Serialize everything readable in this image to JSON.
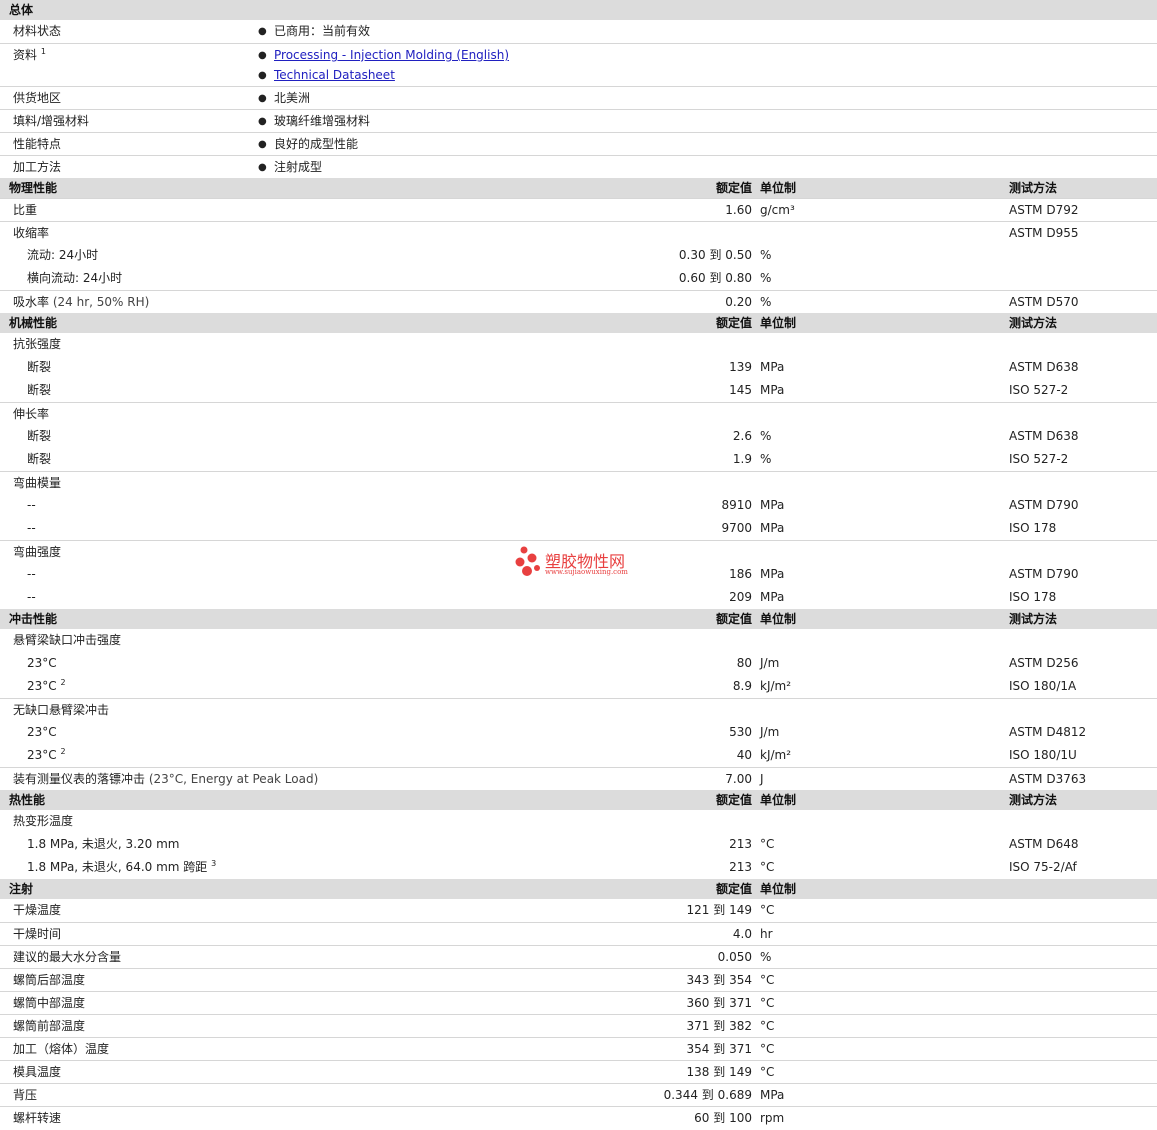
{
  "general": {
    "title": "总体",
    "rows": [
      {
        "label": "材料状态",
        "items": [
          {
            "text": "已商用：当前有效"
          }
        ]
      },
      {
        "label": "资料",
        "note": "1",
        "items": [
          {
            "text": "Processing - Injection Molding (English)",
            "link": true
          },
          {
            "text": "Technical Datasheet",
            "link": true
          }
        ]
      },
      {
        "label": "供货地区",
        "items": [
          {
            "text": "北美洲"
          }
        ]
      },
      {
        "label": "填料/增强材料",
        "items": [
          {
            "text": "玻璃纤维增强材料"
          }
        ]
      },
      {
        "label": "性能特点",
        "items": [
          {
            "text": "良好的成型性能"
          }
        ]
      },
      {
        "label": "加工方法",
        "items": [
          {
            "text": "注射成型"
          }
        ]
      }
    ]
  },
  "col_value": "额定值",
  "col_unit": "单位制",
  "col_method": "测试方法",
  "bullet": "●",
  "to": "到",
  "sections": [
    {
      "title": "物理性能",
      "show_method": true,
      "rows": [
        {
          "label": "比重",
          "value": "1.60",
          "unit": "g/cm³",
          "method": "ASTM D792",
          "line": true
        },
        {
          "label": "收缩率",
          "method": "ASTM D955",
          "line": true
        },
        {
          "label": "流动: 24小时",
          "sub": true,
          "value": "0.30",
          "value2": "0.50",
          "unit": "%"
        },
        {
          "label": "横向流动: 24小时",
          "sub": true,
          "value": "0.60",
          "value2": "0.80",
          "unit": "%"
        },
        {
          "label": "吸水率",
          "cond": "(24 hr, 50% RH)",
          "value": "0.20",
          "unit": "%",
          "method": "ASTM D570",
          "line": true
        }
      ]
    },
    {
      "title": "机械性能",
      "show_method": true,
      "rows": [
        {
          "label": "抗张强度",
          "line": false
        },
        {
          "label": "断裂",
          "sub": true,
          "value": "139",
          "unit": "MPa",
          "method": "ASTM D638"
        },
        {
          "label": "断裂",
          "sub": true,
          "value": "145",
          "unit": "MPa",
          "method": "ISO 527-2"
        },
        {
          "label": "伸长率",
          "line": true
        },
        {
          "label": "断裂",
          "sub": true,
          "value": "2.6",
          "unit": "%",
          "method": "ASTM D638"
        },
        {
          "label": "断裂",
          "sub": true,
          "value": "1.9",
          "unit": "%",
          "method": "ISO 527-2"
        },
        {
          "label": "弯曲模量",
          "line": true
        },
        {
          "label": "--",
          "sub": true,
          "value": "8910",
          "unit": "MPa",
          "method": "ASTM D790"
        },
        {
          "label": "--",
          "sub": true,
          "value": "9700",
          "unit": "MPa",
          "method": "ISO 178"
        },
        {
          "label": "弯曲强度",
          "line": true
        },
        {
          "label": "--",
          "sub": true,
          "value": "186",
          "unit": "MPa",
          "method": "ASTM D790"
        },
        {
          "label": "--",
          "sub": true,
          "value": "209",
          "unit": "MPa",
          "method": "ISO 178"
        }
      ]
    },
    {
      "title": "冲击性能",
      "show_method": true,
      "rows": [
        {
          "label": "悬臂梁缺口冲击强度"
        },
        {
          "label": "23°C",
          "sub": true,
          "value": "80",
          "unit": "J/m",
          "method": "ASTM D256"
        },
        {
          "label": "23°C",
          "note": "2",
          "sub": true,
          "value": "8.9",
          "unit": "kJ/m²",
          "method": "ISO 180/1A"
        },
        {
          "label": "无缺口悬臂梁冲击",
          "line": true
        },
        {
          "label": "23°C",
          "sub": true,
          "value": "530",
          "unit": "J/m",
          "method": "ASTM D4812"
        },
        {
          "label": "23°C",
          "note": "2",
          "sub": true,
          "value": "40",
          "unit": "kJ/m²",
          "method": "ISO 180/1U"
        },
        {
          "label": "装有测量仪表的落镖冲击",
          "cond": "(23°C, Energy at Peak Load)",
          "value": "7.00",
          "unit": "J",
          "method": "ASTM D3763",
          "line": true
        }
      ]
    },
    {
      "title": "热性能",
      "show_method": true,
      "rows": [
        {
          "label": "热变形温度"
        },
        {
          "label": "1.8 MPa, 未退火, 3.20 mm",
          "sub": true,
          "value": "213",
          "unit": "°C",
          "method": "ASTM D648"
        },
        {
          "label": "1.8 MPa, 未退火, 64.0 mm 跨距",
          "note": "3",
          "sub": true,
          "value": "213",
          "unit": "°C",
          "method": "ISO 75-2/Af"
        }
      ]
    },
    {
      "title": "注射",
      "show_method": false,
      "rows": [
        {
          "label": "干燥温度",
          "value": "121",
          "value2": "149",
          "unit": "°C"
        },
        {
          "label": "干燥时间",
          "value": "4.0",
          "unit": "hr",
          "line": true
        },
        {
          "label": "建议的最大水分含量",
          "value": "0.050",
          "unit": "%",
          "line": true
        },
        {
          "label": "螺筒后部温度",
          "value": "343",
          "value2": "354",
          "unit": "°C",
          "line": true
        },
        {
          "label": "螺筒中部温度",
          "value": "360",
          "value2": "371",
          "unit": "°C",
          "line": true
        },
        {
          "label": "螺筒前部温度",
          "value": "371",
          "value2": "382",
          "unit": "°C",
          "line": true
        },
        {
          "label": "加工（熔体）温度",
          "value": "354",
          "value2": "371",
          "unit": "°C",
          "line": true
        },
        {
          "label": "模具温度",
          "value": "138",
          "value2": "149",
          "unit": "°C",
          "line": true
        },
        {
          "label": "背压",
          "value": "0.344",
          "value2": "0.689",
          "unit": "MPa",
          "line": true
        },
        {
          "label": "螺杆转速",
          "value": "60",
          "value2": "100",
          "unit": "rpm",
          "line": true
        }
      ]
    }
  ],
  "watermark": {
    "name": "塑胶物性网",
    "url": "www.sujiaowuxing.com",
    "color": "#e84040"
  }
}
